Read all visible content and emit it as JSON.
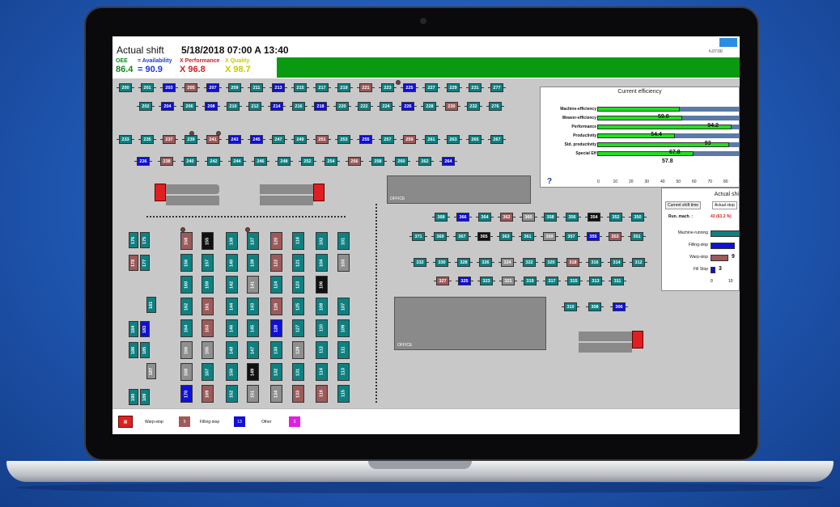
{
  "header": {
    "title": "Actual shift",
    "shift_date": "5/18/2018 07:00 A 13:40",
    "oee_label": "OEE",
    "oee_value": "86.4",
    "availability_label": "= Availability",
    "availability_value": "= 90.9",
    "performance_label": "X Performance",
    "performance_value": "X 96.8",
    "quality_label": "X Quality",
    "quality_value": "X 98.7",
    "top_right_time": "h.07:00"
  },
  "floor": {
    "offices": [
      "OFFICE",
      "OFFICE"
    ],
    "machines_row_a": [
      {
        "id": "200",
        "c": "t"
      },
      {
        "id": "201",
        "c": "t"
      },
      {
        "id": "203",
        "c": "b"
      },
      {
        "id": "205",
        "c": "r"
      },
      {
        "id": "207",
        "c": "b"
      },
      {
        "id": "209",
        "c": "t"
      },
      {
        "id": "211",
        "c": "t"
      },
      {
        "id": "213",
        "c": "b"
      },
      {
        "id": "215",
        "c": "t"
      },
      {
        "id": "217",
        "c": "t"
      },
      {
        "id": "219",
        "c": "t"
      },
      {
        "id": "221",
        "c": "r"
      },
      {
        "id": "223",
        "c": "t"
      },
      {
        "id": "225",
        "c": "b"
      },
      {
        "id": "227",
        "c": "t"
      },
      {
        "id": "229",
        "c": "t"
      },
      {
        "id": "231",
        "c": "t"
      },
      {
        "id": "277",
        "c": "t"
      }
    ],
    "machines_row_b": [
      {
        "id": "202",
        "c": "t"
      },
      {
        "id": "204",
        "c": "b"
      },
      {
        "id": "206",
        "c": "t"
      },
      {
        "id": "208",
        "c": "b"
      },
      {
        "id": "210",
        "c": "t"
      },
      {
        "id": "212",
        "c": "t"
      },
      {
        "id": "214",
        "c": "b"
      },
      {
        "id": "216",
        "c": "t"
      },
      {
        "id": "218",
        "c": "b"
      },
      {
        "id": "220",
        "c": "t"
      },
      {
        "id": "222",
        "c": "t"
      },
      {
        "id": "224",
        "c": "t"
      },
      {
        "id": "226",
        "c": "b"
      },
      {
        "id": "228",
        "c": "t"
      },
      {
        "id": "230",
        "c": "r"
      },
      {
        "id": "232",
        "c": "t"
      },
      {
        "id": "276",
        "c": "t"
      }
    ],
    "machines_row_c": [
      {
        "id": "233",
        "c": "t"
      },
      {
        "id": "235",
        "c": "t"
      },
      {
        "id": "237",
        "c": "r"
      },
      {
        "id": "239",
        "c": "t"
      },
      {
        "id": "241",
        "c": "r"
      },
      {
        "id": "243",
        "c": "b"
      },
      {
        "id": "245",
        "c": "b"
      },
      {
        "id": "247",
        "c": "t"
      },
      {
        "id": "249",
        "c": "t"
      },
      {
        "id": "251",
        "c": "r"
      },
      {
        "id": "253",
        "c": "t"
      },
      {
        "id": "255",
        "c": "b"
      },
      {
        "id": "257",
        "c": "t"
      },
      {
        "id": "259",
        "c": "r"
      },
      {
        "id": "261",
        "c": "t"
      },
      {
        "id": "263",
        "c": "t"
      },
      {
        "id": "265",
        "c": "t"
      },
      {
        "id": "267",
        "c": "t"
      }
    ],
    "machines_row_d": [
      {
        "id": "236",
        "c": "b"
      },
      {
        "id": "238",
        "c": "r"
      },
      {
        "id": "240",
        "c": "t"
      },
      {
        "id": "242",
        "c": "t"
      },
      {
        "id": "244",
        "c": "t"
      },
      {
        "id": "246",
        "c": "t"
      },
      {
        "id": "248",
        "c": "t"
      },
      {
        "id": "252",
        "c": "t"
      },
      {
        "id": "254",
        "c": "t"
      },
      {
        "id": "256",
        "c": "r"
      },
      {
        "id": "258",
        "c": "t"
      },
      {
        "id": "260",
        "c": "t"
      },
      {
        "id": "262",
        "c": "t"
      },
      {
        "id": "264",
        "c": "b"
      }
    ],
    "machines_right_1": [
      {
        "id": "368",
        "c": "t"
      },
      {
        "id": "366",
        "c": "b"
      },
      {
        "id": "364",
        "c": "t"
      },
      {
        "id": "362",
        "c": "r"
      },
      {
        "id": "360",
        "c": "g"
      },
      {
        "id": "358",
        "c": "t"
      },
      {
        "id": "356",
        "c": "t"
      },
      {
        "id": "354",
        "c": "k"
      },
      {
        "id": "352",
        "c": "t"
      },
      {
        "id": "350",
        "c": "t"
      }
    ],
    "machines_right_2": [
      {
        "id": "371",
        "c": "t"
      },
      {
        "id": "369",
        "c": "t"
      },
      {
        "id": "367",
        "c": "t"
      },
      {
        "id": "365",
        "c": "k"
      },
      {
        "id": "363",
        "c": "t"
      },
      {
        "id": "361",
        "c": "t"
      },
      {
        "id": "359",
        "c": "g"
      },
      {
        "id": "357",
        "c": "t"
      },
      {
        "id": "355",
        "c": "b"
      },
      {
        "id": "353",
        "c": "r"
      },
      {
        "id": "351",
        "c": "t"
      }
    ],
    "machines_right_3": [
      {
        "id": "332",
        "c": "t"
      },
      {
        "id": "330",
        "c": "t"
      },
      {
        "id": "328",
        "c": "t"
      },
      {
        "id": "326",
        "c": "t"
      },
      {
        "id": "324",
        "c": "g"
      },
      {
        "id": "322",
        "c": "t"
      },
      {
        "id": "320",
        "c": "t"
      },
      {
        "id": "318",
        "c": "r"
      },
      {
        "id": "316",
        "c": "t"
      },
      {
        "id": "314",
        "c": "t"
      },
      {
        "id": "312",
        "c": "t"
      }
    ],
    "machines_right_4": [
      {
        "id": "327",
        "c": "r"
      },
      {
        "id": "325",
        "c": "b"
      },
      {
        "id": "323",
        "c": "t"
      },
      {
        "id": "321",
        "c": "g"
      },
      {
        "id": "319",
        "c": "t"
      },
      {
        "id": "317",
        "c": "t"
      },
      {
        "id": "315",
        "c": "t"
      },
      {
        "id": "313",
        "c": "t"
      },
      {
        "id": "311",
        "c": "t"
      }
    ],
    "machines_right_5": [
      {
        "id": "310",
        "c": "t"
      },
      {
        "id": "308",
        "c": "t"
      },
      {
        "id": "306",
        "c": "b"
      }
    ],
    "grid_rows": [
      [
        {
          "id": "158",
          "c": "r"
        },
        {
          "id": "155",
          "c": "k"
        },
        {
          "id": "138",
          "c": "t"
        },
        {
          "id": "137",
          "c": "t"
        },
        {
          "id": "120",
          "c": "r"
        },
        {
          "id": "118",
          "c": "t"
        },
        {
          "id": "102",
          "c": "t"
        },
        {
          "id": "101",
          "c": "t"
        }
      ],
      [
        {
          "id": "156",
          "c": "t"
        },
        {
          "id": "157",
          "c": "t"
        },
        {
          "id": "140",
          "c": "t"
        },
        {
          "id": "139",
          "c": "t"
        },
        {
          "id": "122",
          "c": "r"
        },
        {
          "id": "121",
          "c": "t"
        },
        {
          "id": "104",
          "c": "t"
        },
        {
          "id": "103",
          "c": "g"
        }
      ],
      [
        {
          "id": "160",
          "c": "t"
        },
        {
          "id": "159",
          "c": "t"
        },
        {
          "id": "142",
          "c": "t"
        },
        {
          "id": "141",
          "c": "g"
        },
        {
          "id": "124",
          "c": "t"
        },
        {
          "id": "123",
          "c": "t"
        },
        {
          "id": "106",
          "c": "k"
        },
        {
          "id": "",
          "c": "x"
        }
      ],
      [
        {
          "id": "162",
          "c": "t"
        },
        {
          "id": "161",
          "c": "r"
        },
        {
          "id": "144",
          "c": "t"
        },
        {
          "id": "143",
          "c": "t"
        },
        {
          "id": "126",
          "c": "r"
        },
        {
          "id": "125",
          "c": "t"
        },
        {
          "id": "108",
          "c": "t"
        },
        {
          "id": "107",
          "c": "t"
        }
      ],
      [
        {
          "id": "164",
          "c": "t"
        },
        {
          "id": "163",
          "c": "r"
        },
        {
          "id": "146",
          "c": "t"
        },
        {
          "id": "145",
          "c": "t"
        },
        {
          "id": "128",
          "c": "b"
        },
        {
          "id": "127",
          "c": "t"
        },
        {
          "id": "110",
          "c": "t"
        },
        {
          "id": "109",
          "c": "t"
        }
      ],
      [
        {
          "id": "166",
          "c": "g"
        },
        {
          "id": "165",
          "c": "g"
        },
        {
          "id": "148",
          "c": "t"
        },
        {
          "id": "147",
          "c": "t"
        },
        {
          "id": "130",
          "c": "t"
        },
        {
          "id": "129",
          "c": "g"
        },
        {
          "id": "112",
          "c": "t"
        },
        {
          "id": "111",
          "c": "t"
        }
      ],
      [
        {
          "id": "168",
          "c": "g"
        },
        {
          "id": "167",
          "c": "t"
        },
        {
          "id": "150",
          "c": "t"
        },
        {
          "id": "149",
          "c": "k"
        },
        {
          "id": "132",
          "c": "t"
        },
        {
          "id": "131",
          "c": "t"
        },
        {
          "id": "114",
          "c": "t"
        },
        {
          "id": "113",
          "c": "t"
        }
      ],
      [
        {
          "id": "170",
          "c": "b"
        },
        {
          "id": "169",
          "c": "r"
        },
        {
          "id": "152",
          "c": "t"
        },
        {
          "id": "151",
          "c": "g"
        },
        {
          "id": "134",
          "c": "g"
        },
        {
          "id": "133",
          "c": "r"
        },
        {
          "id": "116",
          "c": "r"
        },
        {
          "id": "115",
          "c": "t"
        }
      ]
    ],
    "left_column": [
      {
        "id": "176",
        "c": "t"
      },
      {
        "id": "175",
        "c": "t"
      },
      {
        "id": "178",
        "c": "r"
      },
      {
        "id": "177",
        "c": "t"
      },
      {
        "id": "181",
        "c": "t"
      },
      {
        "id": "184",
        "c": "t"
      },
      {
        "id": "183",
        "c": "b"
      },
      {
        "id": "186",
        "c": "t"
      },
      {
        "id": "185",
        "c": "t"
      },
      {
        "id": "187",
        "c": "g"
      },
      {
        "id": "190",
        "c": "t"
      },
      {
        "id": "189",
        "c": "t"
      }
    ]
  },
  "efficiency": {
    "title": "Current efficiency",
    "rows": [
      {
        "label": "Machine-efficiency",
        "value": "",
        "pct": 0.58
      },
      {
        "label": "Weaver-efficiency",
        "value": "59.8",
        "pct": 0.6
      },
      {
        "label": "Performance",
        "value": "94.2",
        "pct": 0.95
      },
      {
        "label": "Productivity",
        "value": "54.4",
        "pct": 0.55
      },
      {
        "label": "Std. productivity",
        "value": "93",
        "pct": 0.93
      },
      {
        "label": "Special Eff",
        "value": "67.8",
        "pct": 0.68
      }
    ],
    "extra_value": "57.8",
    "ticks": [
      "0",
      "10",
      "20",
      "30",
      "40",
      "50",
      "60",
      "70",
      "80",
      "90"
    ],
    "help": "?"
  },
  "stops": {
    "title": "Actual shi",
    "tab_current": "Current shift time",
    "tab_actual": "Actual stop",
    "run_mach_label": "Run. mach. :",
    "run_mach_value": "43 (63.2 %)",
    "rows": [
      {
        "label": "Machine-running",
        "value": ""
      },
      {
        "label": "Filling-stop",
        "value": ""
      },
      {
        "label": "Warp-stop",
        "value": "9"
      },
      {
        "label": "Fill Stop",
        "value": "3"
      }
    ],
    "ticks": [
      "0",
      "10"
    ]
  },
  "legend": {
    "warp_label": "Warp-stop",
    "warp_count": "9",
    "filling_label": "Filling-stop",
    "filling_count": "13",
    "other_label": "Other",
    "other_count": "3"
  },
  "colors": {
    "teal": "#0f8080",
    "blue": "#1010d8",
    "brown": "#9c5a5a",
    "black": "#111111",
    "gray": "#8f8f8f",
    "green": "#20e020"
  }
}
